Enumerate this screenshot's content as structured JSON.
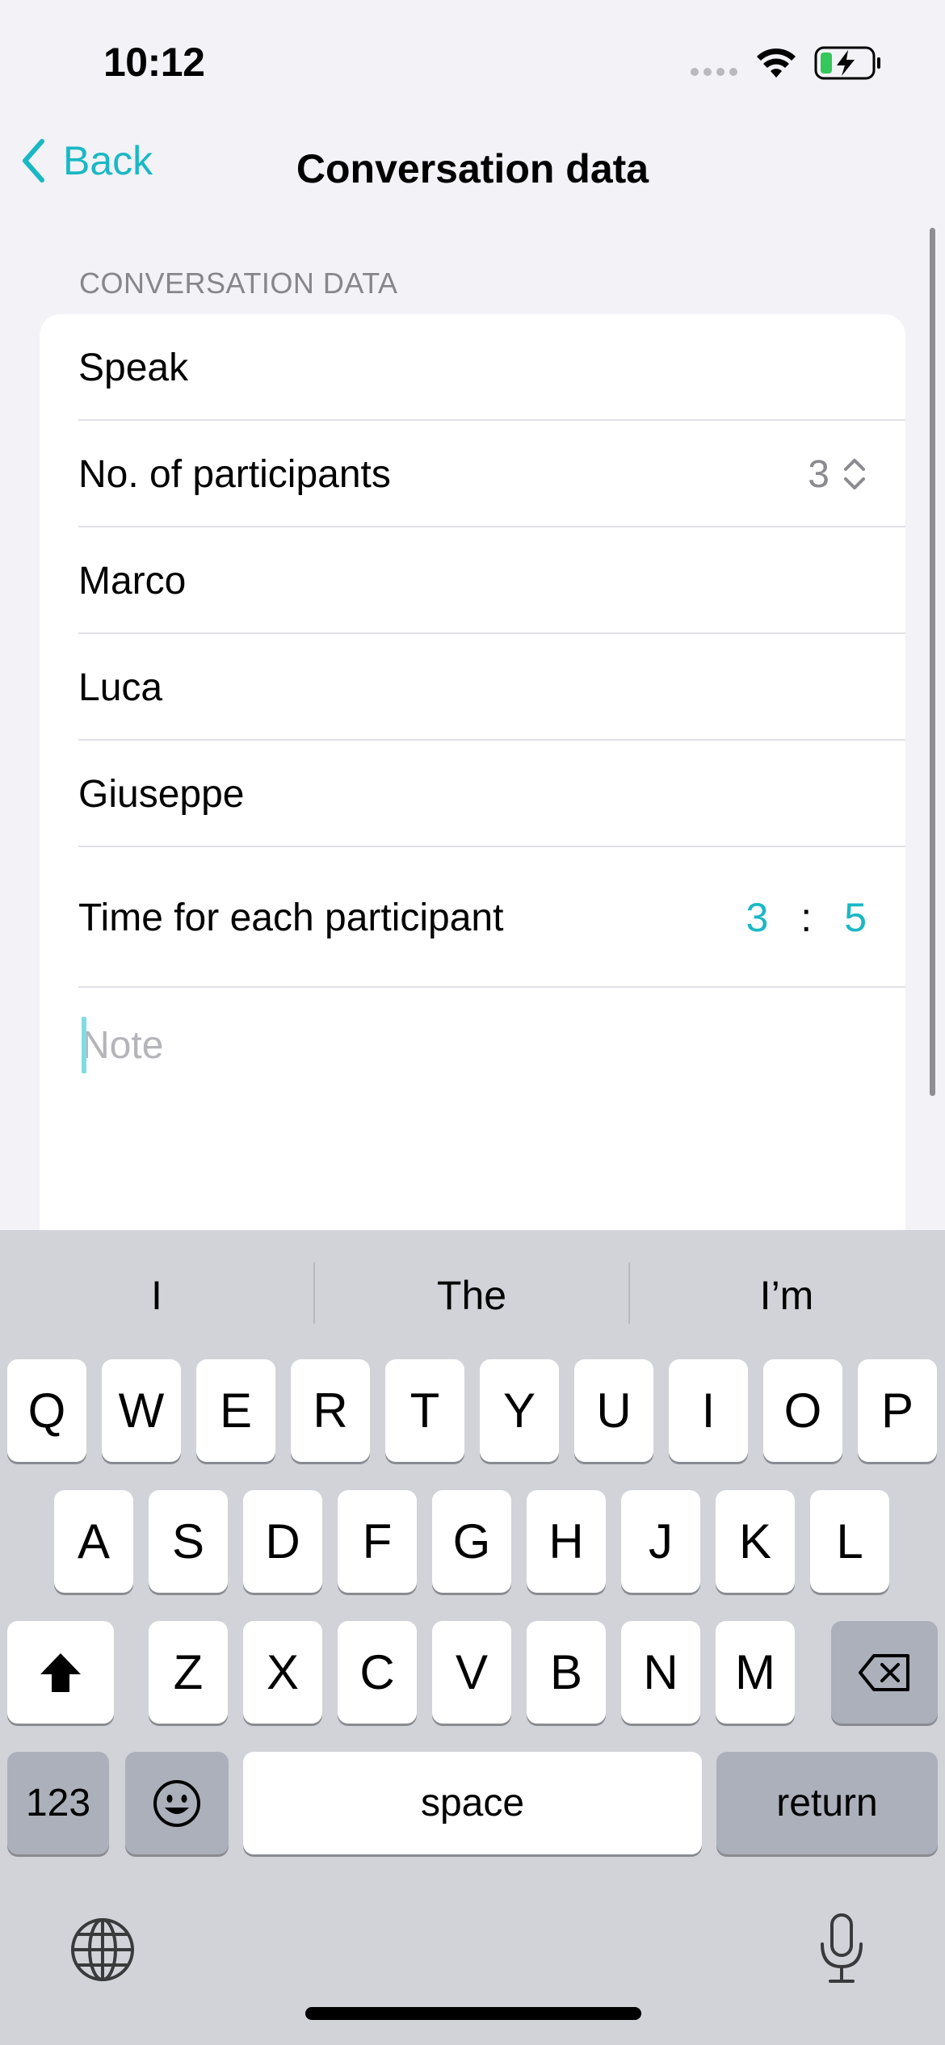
{
  "status_bar": {
    "time": "10:12"
  },
  "nav": {
    "back_label": "Back",
    "title": "Conversation data"
  },
  "section": {
    "header": "CONVERSATION DATA",
    "speak_label": "Speak",
    "participants_label": "No. of participants",
    "participants_count": "3",
    "participants": [
      "Marco",
      "Luca",
      "Giuseppe"
    ],
    "time_label": "Time for each participant",
    "time_minutes": "3",
    "time_separator": ":",
    "time_seconds": "5",
    "note_placeholder": "Note"
  },
  "keyboard": {
    "suggestions": [
      "I",
      "The",
      "I’m"
    ],
    "row1": [
      "Q",
      "W",
      "E",
      "R",
      "T",
      "Y",
      "U",
      "I",
      "O",
      "P"
    ],
    "row2": [
      "A",
      "S",
      "D",
      "F",
      "G",
      "H",
      "J",
      "K",
      "L"
    ],
    "row3": [
      "Z",
      "X",
      "C",
      "V",
      "B",
      "N",
      "M"
    ],
    "numbers_label": "123",
    "space_label": "space",
    "return_label": "return"
  },
  "colors": {
    "accent": "#1ab8c4",
    "background": "#f2f2f7",
    "keyboard": "#d1d3d9"
  }
}
